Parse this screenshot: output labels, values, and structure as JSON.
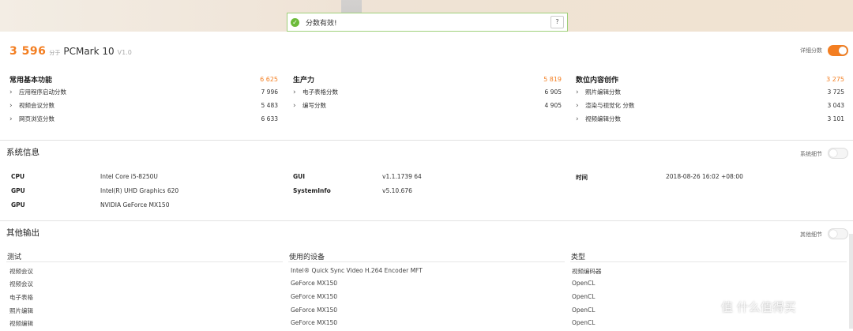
{
  "toast": {
    "message": "分数有效!",
    "help": "?"
  },
  "header": {
    "score": "3 596",
    "score_unit": "分于",
    "product": "PCMark 10",
    "version": "V1.0",
    "detail_toggle_label": "详细分数",
    "detail_toggle_on": true
  },
  "categories": [
    {
      "name": "常用基本功能",
      "value": "6 625",
      "items": [
        {
          "label": "应用程序启动分数",
          "value": "7 996"
        },
        {
          "label": "视频会议分数",
          "value": "5 483"
        },
        {
          "label": "网页浏览分数",
          "value": "6 633"
        }
      ]
    },
    {
      "name": "生产力",
      "value": "5 819",
      "items": [
        {
          "label": "电子表格分数",
          "value": "6 905"
        },
        {
          "label": "编写分数",
          "value": "4 905"
        }
      ]
    },
    {
      "name": "数位内容创作",
      "value": "3 275",
      "items": [
        {
          "label": "照片编辑分数",
          "value": "3 725"
        },
        {
          "label": "渲染与视觉化 分数",
          "value": "3 043"
        },
        {
          "label": "视频编辑分数",
          "value": "3 101"
        }
      ]
    }
  ],
  "system": {
    "title": "系统信息",
    "toggle_label": "系统细节",
    "rows": [
      {
        "key": "CPU",
        "value": "Intel Core i5-8250U"
      },
      {
        "key": "GPU",
        "value": "Intel(R) UHD Graphics 620"
      },
      {
        "key": "GPU",
        "value": "NVIDIA GeForce MX150"
      },
      {
        "key": "GUI",
        "value": "v1.1.1739 64"
      },
      {
        "key": "SystemInfo",
        "value": "v5.10.676"
      },
      {
        "key": "时间",
        "value": "2018-08-26 16:02 +08:00"
      }
    ]
  },
  "other": {
    "title": "其他输出",
    "toggle_label": "其他细节",
    "headers": [
      "测试",
      "使用的设备",
      "类型"
    ],
    "rows": [
      [
        "视频会议",
        "Intel® Quick Sync Video H.264 Encoder MFT",
        "视频编码器"
      ],
      [
        "视频会议",
        "GeForce MX150",
        "OpenCL"
      ],
      [
        "电子表格",
        "GeForce MX150",
        "OpenCL"
      ],
      [
        "照片编辑",
        "GeForce MX150",
        "OpenCL"
      ],
      [
        "视频编辑",
        "GeForce MX150",
        "OpenCL"
      ]
    ]
  },
  "watermark": "值 什么值得买"
}
